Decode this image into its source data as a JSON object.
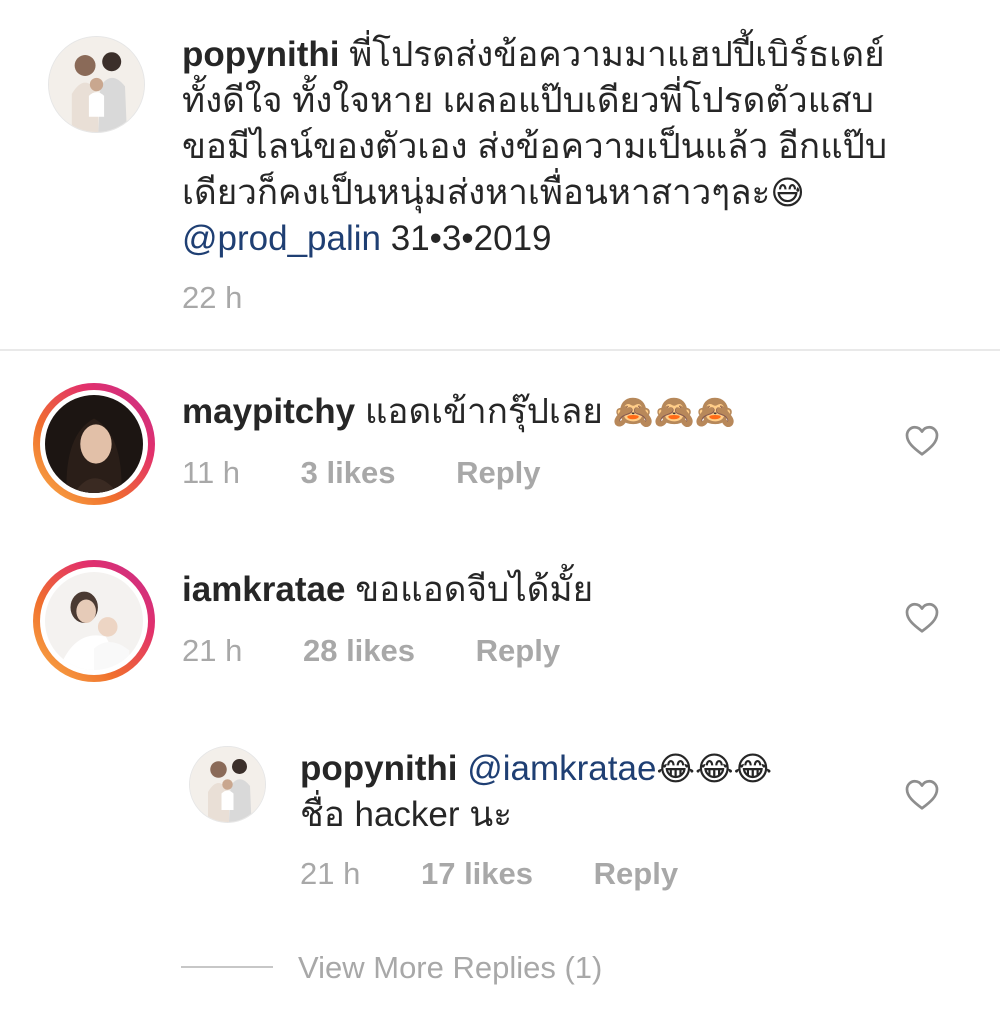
{
  "comments": [
    {
      "username": "popynithi",
      "text": "พี่โปรดส่งข้อความมาแฮปปี้เบิร์ธเดย์ ทั้งดีใจ ทั้งใจหาย เผลอแป๊บเดียวพี่โปรดตัวแสบขอมีไลน์ของตัวเอง ส่งข้อความเป็นแล้ว อีกแป๊บเดียวก็คงเป็นหนุ่มส่งหาเพื่อนหาสาวๆละ",
      "emoji": "😅",
      "mention": "@prod_palin",
      "date": "31•3•2019",
      "time": "22 h"
    },
    {
      "username": "maypitchy",
      "text": "แอดเข้ากรุ๊ปเลย",
      "emoji": "🙈🙈🙈",
      "time": "11 h",
      "likes": "3 likes",
      "reply": "Reply"
    },
    {
      "username": "iamkratae",
      "text": "ขอแอดจีบได้มั้ย",
      "time": "21 h",
      "likes": "28 likes",
      "reply": "Reply"
    }
  ],
  "reply": {
    "username": "popynithi",
    "mention": "@iamkratae",
    "emoji": "😂😂😂",
    "text": "ชื่อ hacker นะ",
    "time": "21 h",
    "likes": "17 likes",
    "reply": "Reply"
  },
  "view_more": "View More Replies (1)",
  "icons": {
    "like": "heart-outline-icon"
  },
  "colors": {
    "text": "#262626",
    "meta": "#a8a8a8",
    "mention": "#1f3f73",
    "story_ring_start": "#f9b24a",
    "story_ring_end": "#c42f8c"
  }
}
